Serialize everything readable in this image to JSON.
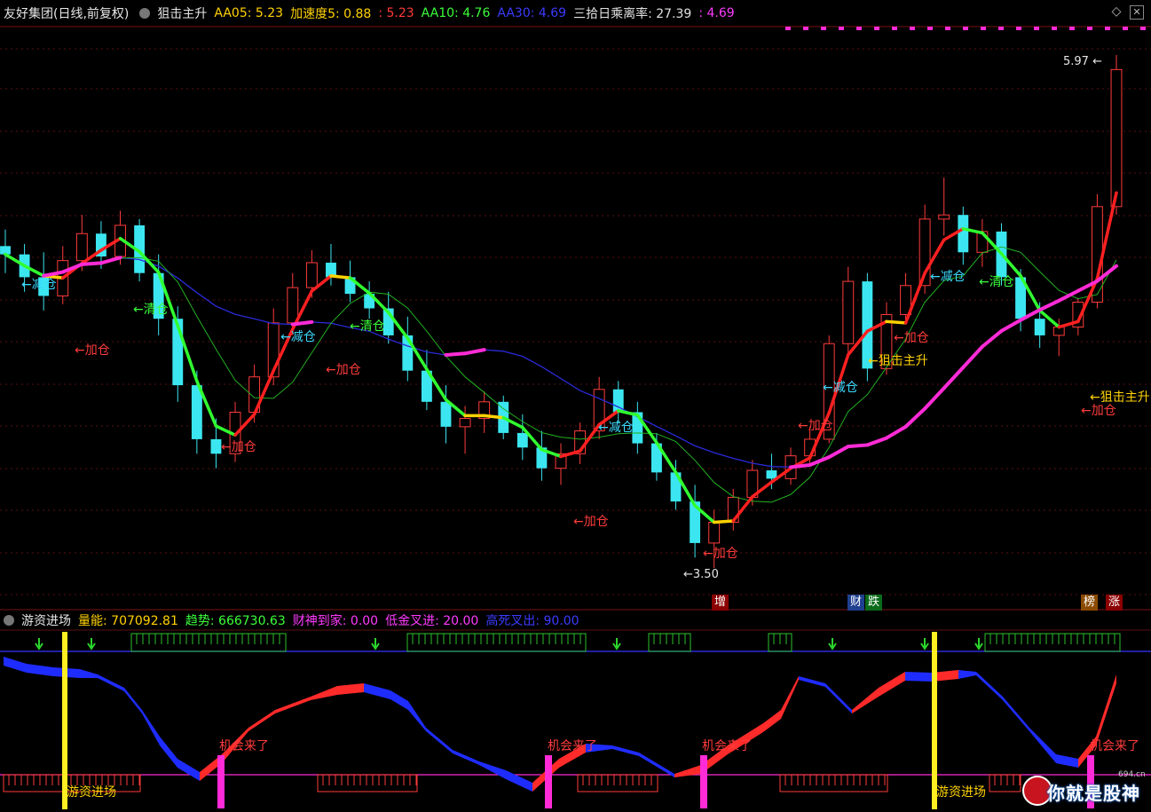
{
  "header": {
    "security_name": "友好集团(日线,前复权)",
    "indicator_name": "狙击主升",
    "items": [
      {
        "label": "AA05: 5.23",
        "color": "#ffd200"
      },
      {
        "label": "加速度5: 0.88",
        "color": "#ffd200"
      },
      {
        "label": ": 5.23",
        "color": "#ff3b3b"
      },
      {
        "label": "AA10: 4.76",
        "color": "#3bff3b"
      },
      {
        "label": "AA30: 4.69",
        "color": "#3b3bff"
      },
      {
        "label": "三拾日乘离率: 27.39",
        "color": "#e0e0e0"
      },
      {
        "label": ": 4.69",
        "color": "#ff3bff"
      }
    ]
  },
  "main_chart": {
    "high_label": "5.97",
    "low_label": "3.50",
    "annotations": [
      {
        "text": "←减仓",
        "color": "#3bd9ff"
      },
      {
        "text": "←清仓",
        "color": "#3bff3b"
      },
      {
        "text": "←加仓",
        "color": "#ff3b3b"
      },
      {
        "text": "←减仓",
        "color": "#3bd9ff"
      },
      {
        "text": "←清仓",
        "color": "#3bff3b"
      },
      {
        "text": "←加仓",
        "color": "#ff3b3b"
      },
      {
        "text": "←加仓",
        "color": "#ff3b3b"
      },
      {
        "text": "←减仓",
        "color": "#3bd9ff"
      },
      {
        "text": "←加仓",
        "color": "#ff3b3b"
      },
      {
        "text": "←加仓",
        "color": "#ff3b3b"
      },
      {
        "text": "←减仓",
        "color": "#3bd9ff"
      },
      {
        "text": "←加仓",
        "color": "#ff3b3b"
      },
      {
        "text": "←狙击主升",
        "color": "#ffd200"
      },
      {
        "text": "←减仓",
        "color": "#3bd9ff"
      },
      {
        "text": "←加仓",
        "color": "#ff3b3b"
      },
      {
        "text": "←清仓",
        "color": "#3bff3b"
      },
      {
        "text": "←狙击主升",
        "color": "#ffd200"
      },
      {
        "text": "←加仓",
        "color": "#ff3b3b"
      }
    ],
    "event_chips": [
      {
        "text": "增",
        "bg": "#8b0000"
      },
      {
        "text": "财",
        "bg": "#1f3f8f"
      },
      {
        "text": "跌",
        "bg": "#0a6b1a"
      },
      {
        "text": "榜",
        "bg": "#8b4a00"
      },
      {
        "text": "涨",
        "bg": "#8b0000"
      }
    ]
  },
  "sub_chart": {
    "title": "游资进场",
    "items": [
      {
        "label": "量能: 707092.81",
        "color": "#ffd200"
      },
      {
        "label": "趋势: 666730.63",
        "color": "#3bff3b"
      },
      {
        "label": "财神到家: 0.00",
        "color": "#ff3bff"
      },
      {
        "label": "低金叉进: 20.00",
        "color": "#ff3bff"
      },
      {
        "label": "高死叉出: 90.00",
        "color": "#3b3bff"
      }
    ],
    "signals": [
      {
        "text": "游资进场",
        "color": "#ffd200"
      },
      {
        "text": "机会来了",
        "color": "#ff3b3b"
      },
      {
        "text": "机会来了",
        "color": "#ff3b3b"
      },
      {
        "text": "机会来了",
        "color": "#ff3b3b"
      },
      {
        "text": "游资进场",
        "color": "#ffd200"
      },
      {
        "text": "机会来了",
        "color": "#ff3b3b"
      }
    ]
  },
  "watermark": {
    "text": "你就是股神",
    "url": "694.cn"
  },
  "chart_data": {
    "type": "candlestick",
    "price_axis": {
      "low": 3.5,
      "high": 5.97
    },
    "candles": [
      [
        5.05,
        5.13,
        4.92,
        5.01
      ],
      [
        5.01,
        5.06,
        4.83,
        4.9
      ],
      [
        4.9,
        5.02,
        4.74,
        4.81
      ],
      [
        4.81,
        5.05,
        4.77,
        4.98
      ],
      [
        4.98,
        5.2,
        4.93,
        5.11
      ],
      [
        5.11,
        5.17,
        4.94,
        5.0
      ],
      [
        5.0,
        5.22,
        4.96,
        5.15
      ],
      [
        5.15,
        5.18,
        4.88,
        4.92
      ],
      [
        4.92,
        5.01,
        4.62,
        4.7
      ],
      [
        4.7,
        4.76,
        4.3,
        4.38
      ],
      [
        4.38,
        4.45,
        4.05,
        4.12
      ],
      [
        4.12,
        4.22,
        3.98,
        4.05
      ],
      [
        4.05,
        4.3,
        4.01,
        4.25
      ],
      [
        4.25,
        4.48,
        4.2,
        4.42
      ],
      [
        4.42,
        4.75,
        4.38,
        4.68
      ],
      [
        4.68,
        4.92,
        4.62,
        4.85
      ],
      [
        4.85,
        5.03,
        4.8,
        4.97
      ],
      [
        4.97,
        5.06,
        4.86,
        4.9
      ],
      [
        4.9,
        4.98,
        4.78,
        4.82
      ],
      [
        4.82,
        4.88,
        4.7,
        4.75
      ],
      [
        4.75,
        4.83,
        4.58,
        4.62
      ],
      [
        4.62,
        4.71,
        4.4,
        4.45
      ],
      [
        4.45,
        4.55,
        4.26,
        4.3
      ],
      [
        4.3,
        4.38,
        4.1,
        4.18
      ],
      [
        4.18,
        4.28,
        4.05,
        4.22
      ],
      [
        4.22,
        4.35,
        4.15,
        4.3
      ],
      [
        4.3,
        4.33,
        4.12,
        4.15
      ],
      [
        4.15,
        4.24,
        4.02,
        4.08
      ],
      [
        4.08,
        4.16,
        3.92,
        3.98
      ],
      [
        3.98,
        4.1,
        3.9,
        4.05
      ],
      [
        4.05,
        4.2,
        4.0,
        4.16
      ],
      [
        4.16,
        4.42,
        4.12,
        4.36
      ],
      [
        4.36,
        4.4,
        4.2,
        4.25
      ],
      [
        4.25,
        4.3,
        4.05,
        4.1
      ],
      [
        4.1,
        4.15,
        3.92,
        3.96
      ],
      [
        3.96,
        4.02,
        3.78,
        3.82
      ],
      [
        3.82,
        3.9,
        3.55,
        3.62
      ],
      [
        3.62,
        3.78,
        3.5,
        3.72
      ],
      [
        3.72,
        3.88,
        3.68,
        3.84
      ],
      [
        3.84,
        4.02,
        3.8,
        3.97
      ],
      [
        3.97,
        4.05,
        3.88,
        3.93
      ],
      [
        3.93,
        4.08,
        3.9,
        4.04
      ],
      [
        4.04,
        4.18,
        4.0,
        4.12
      ],
      [
        4.12,
        4.62,
        4.1,
        4.58
      ],
      [
        4.58,
        4.95,
        4.52,
        4.88
      ],
      [
        4.88,
        4.92,
        4.4,
        4.46
      ],
      [
        4.46,
        4.78,
        4.43,
        4.72
      ],
      [
        4.72,
        4.92,
        4.68,
        4.86
      ],
      [
        4.86,
        5.25,
        4.82,
        5.18
      ],
      [
        5.18,
        5.38,
        5.1,
        5.2
      ],
      [
        5.2,
        5.24,
        4.96,
        5.02
      ],
      [
        5.02,
        5.18,
        4.95,
        5.12
      ],
      [
        5.12,
        5.16,
        4.86,
        4.9
      ],
      [
        4.9,
        4.94,
        4.64,
        4.7
      ],
      [
        4.7,
        4.78,
        4.56,
        4.62
      ],
      [
        4.62,
        4.7,
        4.52,
        4.66
      ],
      [
        4.66,
        4.8,
        4.62,
        4.78
      ],
      [
        4.78,
        5.3,
        4.75,
        5.24
      ],
      [
        5.24,
        5.97,
        5.2,
        5.9
      ]
    ]
  }
}
